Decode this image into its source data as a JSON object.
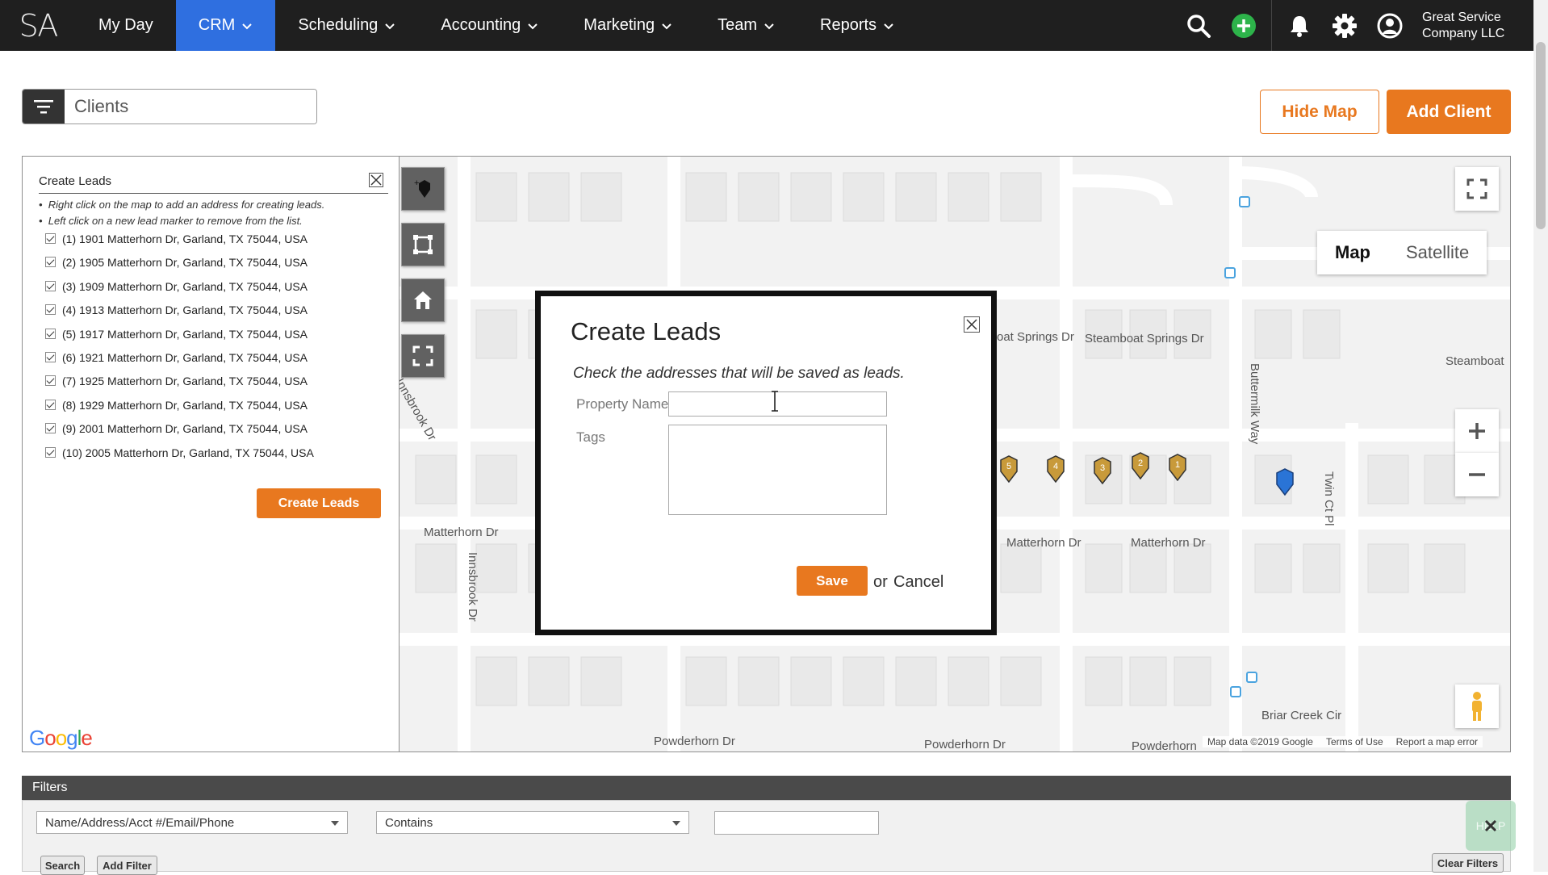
{
  "nav": {
    "logo": "SA",
    "items": [
      {
        "label": "My Day",
        "dropdown": false,
        "active": false
      },
      {
        "label": "CRM",
        "dropdown": true,
        "active": true
      },
      {
        "label": "Scheduling",
        "dropdown": true,
        "active": false
      },
      {
        "label": "Accounting",
        "dropdown": true,
        "active": false
      },
      {
        "label": "Marketing",
        "dropdown": true,
        "active": false
      },
      {
        "label": "Team",
        "dropdown": true,
        "active": false
      },
      {
        "label": "Reports",
        "dropdown": true,
        "active": false
      }
    ],
    "company_line1": "Great Service",
    "company_line2": "Company LLC",
    "active_color": "#2f6fe0"
  },
  "toolbar": {
    "filter_value": "Clients",
    "hide_map_label": "Hide Map",
    "add_client_label": "Add Client",
    "accent_color": "#e8781f"
  },
  "leads_panel": {
    "title": "Create Leads",
    "hints": [
      "Right click on the map to add an address for creating leads.",
      "Left click on a new lead marker to remove from the list."
    ],
    "addresses": [
      "(1) 1901 Matterhorn Dr, Garland, TX 75044, USA",
      "(2) 1905 Matterhorn Dr, Garland, TX 75044, USA",
      "(3) 1909 Matterhorn Dr, Garland, TX 75044, USA",
      "(4) 1913 Matterhorn Dr, Garland, TX 75044, USA",
      "(5) 1917 Matterhorn Dr, Garland, TX 75044, USA",
      "(6) 1921 Matterhorn Dr, Garland, TX 75044, USA",
      "(7) 1925 Matterhorn Dr, Garland, TX 75044, USA",
      "(8) 1929 Matterhorn Dr, Garland, TX 75044, USA",
      "(9) 2001 Matterhorn Dr, Garland, TX 75044, USA",
      "(10) 2005 Matterhorn Dr, Garland, TX 75044, USA"
    ],
    "create_button": "Create Leads",
    "google_logo": "Google"
  },
  "map": {
    "type_map": "Map",
    "type_satellite": "Satellite",
    "streets": {
      "matterhorn_left": "Matterhorn Dr",
      "matterhorn_mid": "Matterhorn Dr",
      "matterhorn_right": "Matterhorn Dr",
      "innsbrook_top": "Innsbrook Dr",
      "innsbrook_bottom": "Innsbrook Dr",
      "steamboat_a": "oat Springs Dr",
      "steamboat_b": "Steamboat Springs Dr",
      "steamboat_c": "Steamboat",
      "buttermilk": "Buttermilk Way",
      "twin_ct": "Twin Ct Pl",
      "briar_creek": "Briar Creek Cir",
      "powderhorn_left": "Powderhorn Dr",
      "powderhorn_mid": "Powderhorn Dr",
      "powderhorn_right": "Powderhorn"
    },
    "markers": [
      "5",
      "4",
      "3",
      "2",
      "1"
    ],
    "attribution": [
      "Map data ©2019 Google",
      "Terms of Use",
      "Report a map error"
    ]
  },
  "dialog": {
    "title": "Create Leads",
    "description": "Check the addresses that will be saved as leads.",
    "property_label": "Property Name",
    "property_value": "",
    "tags_label": "Tags",
    "save_label": "Save",
    "or_text": "or",
    "cancel_label": "Cancel"
  },
  "filters": {
    "title": "Filters",
    "field_select": "Name/Address/Acct #/Email/Phone",
    "operator_select": "Contains",
    "search_label": "Search",
    "add_filter_label": "Add Filter",
    "clear_filters_label": "Clear Filters",
    "help_label": "HELP"
  }
}
